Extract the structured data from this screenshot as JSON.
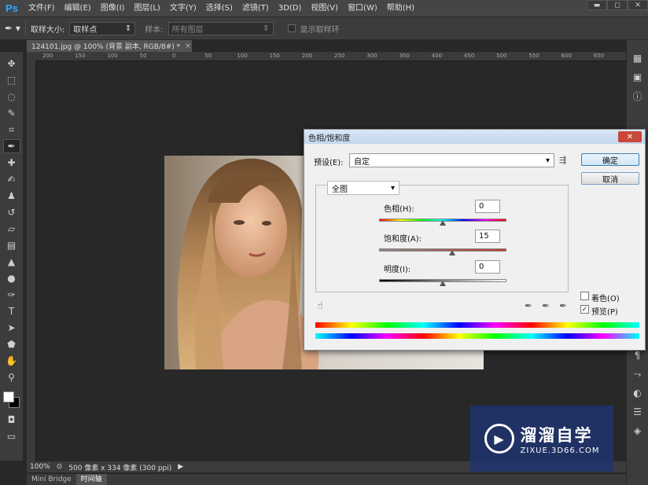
{
  "app": {
    "logo": "Ps"
  },
  "menu": [
    "文件(F)",
    "编辑(E)",
    "图像(I)",
    "图层(L)",
    "文字(Y)",
    "选择(S)",
    "滤镜(T)",
    "3D(D)",
    "视图(V)",
    "窗口(W)",
    "帮助(H)"
  ],
  "window_controls": [
    "▬",
    "◻",
    "✕"
  ],
  "options": {
    "sample_size_label": "取样大小:",
    "sample_size_value": "取样点",
    "sample_label": "样本:",
    "sample_value": "所有图层",
    "show_ring_label": "显示取样环"
  },
  "document": {
    "tab_title": "124101.jpg @ 100% (背景 副本, RGB/8#) *",
    "close": "×"
  },
  "ruler_h": [
    "200",
    "150",
    "100",
    "50",
    "0",
    "50",
    "100",
    "150",
    "200",
    "250",
    "300",
    "350",
    "400",
    "450",
    "500",
    "550",
    "600",
    "650"
  ],
  "tools": [
    {
      "icon": "move-icon",
      "glyph": "✥"
    },
    {
      "icon": "marquee-icon",
      "glyph": "⬚"
    },
    {
      "icon": "lasso-icon",
      "glyph": "◌"
    },
    {
      "icon": "quick-select-icon",
      "glyph": "✎"
    },
    {
      "icon": "crop-icon",
      "glyph": "⌗"
    },
    {
      "icon": "eyedropper-icon",
      "glyph": "✒"
    },
    {
      "icon": "healing-icon",
      "glyph": "✚"
    },
    {
      "icon": "brush-icon",
      "glyph": "✍"
    },
    {
      "icon": "stamp-icon",
      "glyph": "♟"
    },
    {
      "icon": "history-brush-icon",
      "glyph": "↺"
    },
    {
      "icon": "eraser-icon",
      "glyph": "▱"
    },
    {
      "icon": "gradient-icon",
      "glyph": "▤"
    },
    {
      "icon": "blur-icon",
      "glyph": "▲"
    },
    {
      "icon": "dodge-icon",
      "glyph": "●"
    },
    {
      "icon": "pen-icon",
      "glyph": "✑"
    },
    {
      "icon": "type-icon",
      "glyph": "T"
    },
    {
      "icon": "path-select-icon",
      "glyph": "➤"
    },
    {
      "icon": "shape-icon",
      "glyph": "⬟"
    },
    {
      "icon": "hand-icon",
      "glyph": "✋"
    },
    {
      "icon": "zoom-icon",
      "glyph": "⚲"
    }
  ],
  "dock": [
    {
      "icon": "history-panel-icon",
      "glyph": "▦"
    },
    {
      "icon": "adjust-panel-icon",
      "glyph": "▣"
    },
    {
      "icon": "info-panel-icon",
      "glyph": "ⓘ"
    },
    {
      "icon": "text-panel-icon",
      "glyph": "¶"
    },
    {
      "icon": "paths-panel-icon",
      "glyph": "⤳"
    },
    {
      "icon": "brush-panel-icon",
      "glyph": "◐"
    },
    {
      "icon": "properties-panel-icon",
      "glyph": "☰"
    },
    {
      "icon": "layers-panel-icon",
      "glyph": "◈"
    }
  ],
  "status": {
    "zoom": "100%",
    "doc_info": "500 像素 x 334 像素 (300 ppi)"
  },
  "bottom_tabs": [
    "Mini Bridge",
    "时间轴"
  ],
  "dialog": {
    "title": "色相/饱和度",
    "preset_label": "预设(E):",
    "preset_value": "自定",
    "channel_value": "全图",
    "hue_label": "色相(H):",
    "hue_value": "0",
    "saturation_label": "饱和度(A):",
    "saturation_value": "15",
    "lightness_label": "明度(I):",
    "lightness_value": "0",
    "ok_label": "确定",
    "cancel_label": "取消",
    "colorize_label": "着色(O)",
    "preview_label": "预览(P)",
    "preview_checked": "✓",
    "close_glyph": "✕"
  },
  "watermark": {
    "title": "溜溜自学",
    "subtitle": "ZIXUE.3D66.COM"
  }
}
